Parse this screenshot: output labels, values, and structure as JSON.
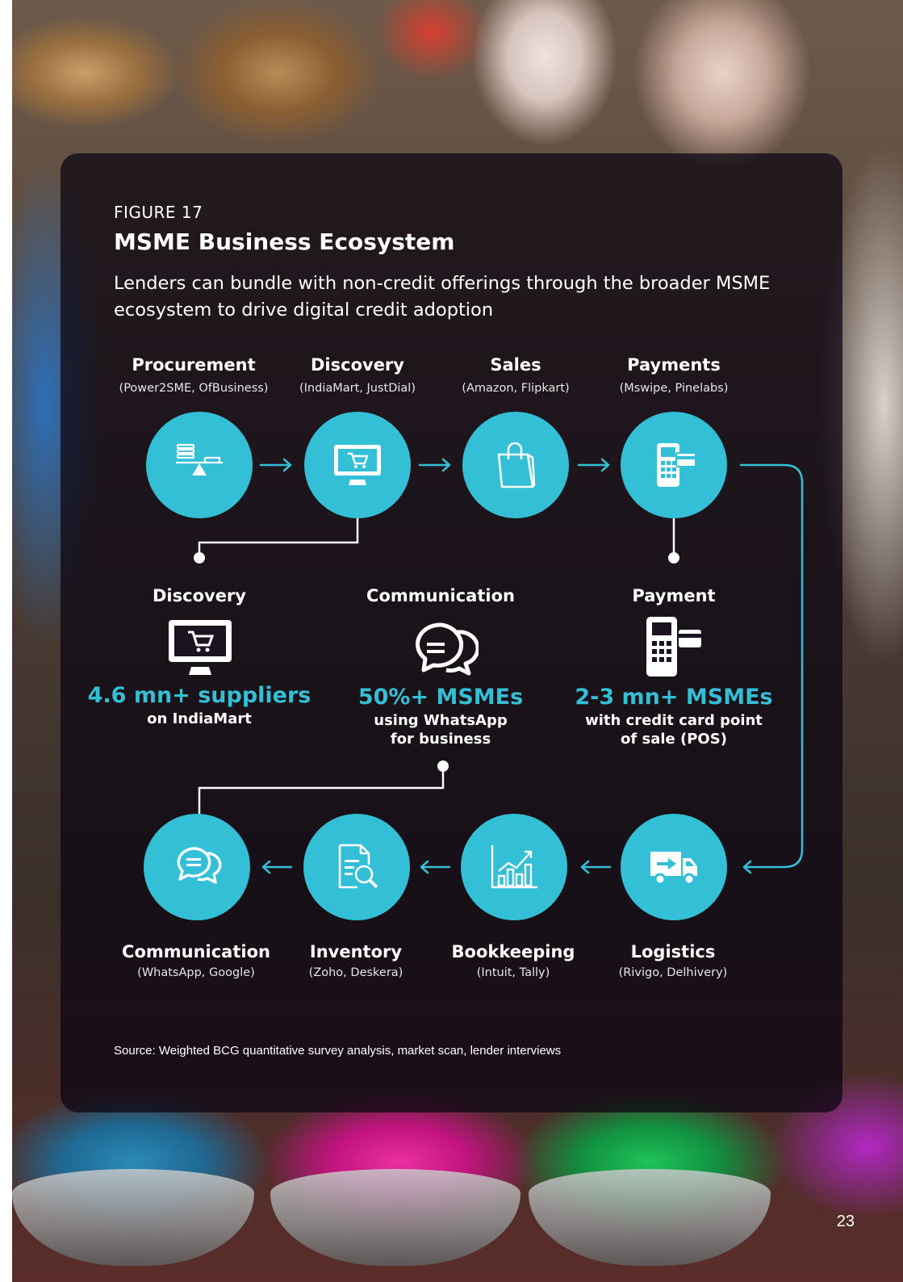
{
  "figure": {
    "label": "FIGURE 17",
    "title": "MSME Business Ecosystem",
    "subtitle": "Lenders can bundle with non-credit offerings through the broader MSME ecosystem to drive digital credit adoption"
  },
  "top_stages": [
    {
      "title": "Procurement",
      "examples": "(Power2SME, OfBusiness)",
      "icon": "scale-icon"
    },
    {
      "title": "Discovery",
      "examples": "(IndiaMart, JustDial)",
      "icon": "monitor-cart-icon"
    },
    {
      "title": "Sales",
      "examples": "(Amazon, Flipkart)",
      "icon": "shopping-bag-icon"
    },
    {
      "title": "Payments",
      "examples": "(Mswipe, Pinelabs)",
      "icon": "pos-terminal-icon"
    }
  ],
  "highlights": [
    {
      "title": "Discovery",
      "stat": "4.6 mn+ suppliers",
      "detail_1": "on IndiaMart",
      "detail_2": "",
      "icon": "monitor-cart-icon"
    },
    {
      "title": "Communication",
      "stat": "50%+ MSMEs",
      "detail_1": "using WhatsApp",
      "detail_2": "for business",
      "icon": "chat-bubbles-icon"
    },
    {
      "title": "Payment",
      "stat": "2-3 mn+ MSMEs",
      "detail_1": "with credit card point",
      "detail_2": "of sale (POS)",
      "icon": "pos-terminal-icon"
    }
  ],
  "bottom_stages": [
    {
      "title": "Communication",
      "examples": "(WhatsApp, Google)",
      "icon": "chat-bubbles-icon"
    },
    {
      "title": "Inventory",
      "examples": "(Zoho, Deskera)",
      "icon": "document-search-icon"
    },
    {
      "title": "Bookkeeping",
      "examples": "(Intuit, Tally)",
      "icon": "bar-chart-icon"
    },
    {
      "title": "Logistics",
      "examples": "(Rivigo, Delhivery)",
      "icon": "truck-icon"
    }
  ],
  "source": "Source: Weighted BCG quantitative survey analysis, market scan, lender interviews",
  "page_number": "23",
  "colors": {
    "accent": "#33bfd5",
    "panel": "#0a0410",
    "text": "#ffffff"
  }
}
